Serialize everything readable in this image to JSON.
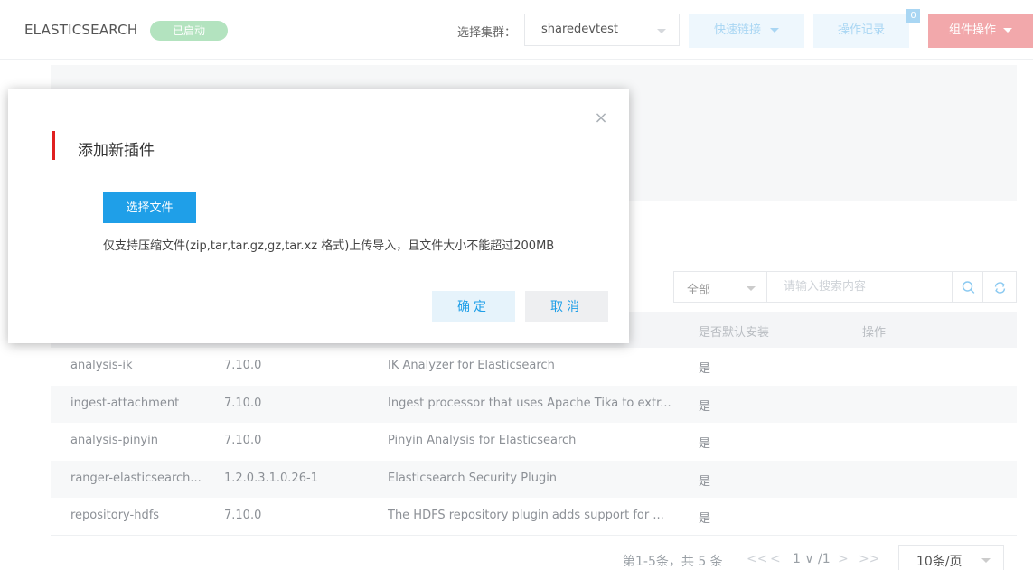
{
  "header": {
    "app_title": "ELASTICSEARCH",
    "status_badge": "已启动",
    "cluster_label": "选择集群：",
    "cluster_value": "sharedevtest",
    "quick_link_label": "快速链接",
    "op_log_label": "操作记录",
    "op_log_count": "0",
    "component_op_label": "组件操作"
  },
  "filter": {
    "scope_value": "全部",
    "search_placeholder": "请输入搜索内容",
    "icons": {
      "search": "search-icon",
      "refresh": "refresh-icon"
    }
  },
  "table": {
    "headers": {
      "default_install": "是否默认安装",
      "actions": "操作"
    },
    "rows": [
      {
        "name": "analysis-ik",
        "version": "7.10.0",
        "description": "IK Analyzer for Elasticsearch",
        "default_install": "是"
      },
      {
        "name": "ingest-attachment",
        "version": "7.10.0",
        "description": "Ingest processor that uses Apache Tika to extr...",
        "default_install": "是"
      },
      {
        "name": "analysis-pinyin",
        "version": "7.10.0",
        "description": "Pinyin Analysis for Elasticsearch",
        "default_install": "是"
      },
      {
        "name": "ranger-elasticsearch...",
        "version": "1.2.0.3.1.0.26-1",
        "description": "Elasticsearch Security Plugin",
        "default_install": "是"
      },
      {
        "name": "repository-hdfs",
        "version": "7.10.0",
        "description": "The HDFS repository plugin adds support for ...",
        "default_install": "是"
      }
    ]
  },
  "pagination": {
    "info": "第1-5条，共 5 条",
    "first": "<<",
    "prev": "<",
    "current": "1 ∨ /1",
    "next": ">",
    "last": ">>",
    "page_size": "10条/页"
  },
  "modal": {
    "title": "添加新插件",
    "choose_file_label": "选择文件",
    "hint": "仅支持压缩文件(zip,tar,tar.gz,gz,tar.xz 格式)上传导入，且文件大小不能超过200MB",
    "ok_label": "确定",
    "cancel_label": "取消",
    "close_glyph": "×"
  },
  "colors": {
    "accent": "#1f9fe8",
    "title_bar": "#e02020",
    "status_green": "#b3e3bf",
    "danger_button": "#f2a8ab"
  }
}
